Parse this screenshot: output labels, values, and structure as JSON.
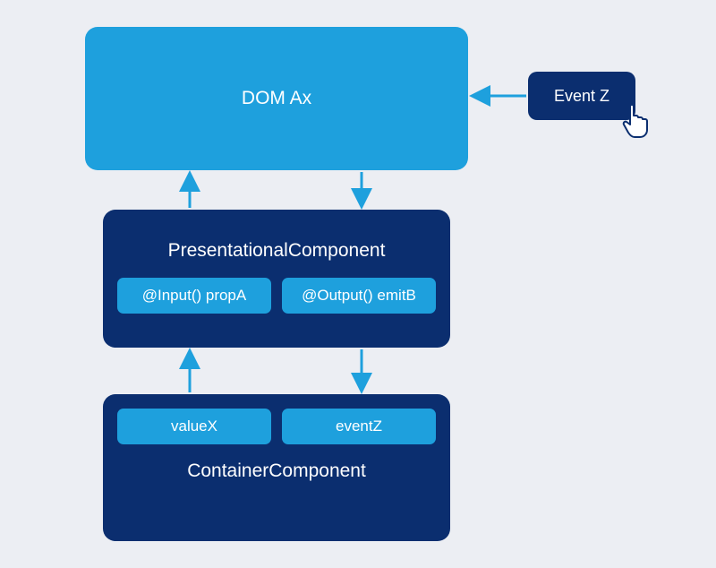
{
  "dom": {
    "label": "DOM Ax"
  },
  "event": {
    "label": "Event Z"
  },
  "presentational": {
    "title": "PresentationalComponent",
    "input_pill": "@Input() propA",
    "output_pill": "@Output() emitB"
  },
  "container": {
    "title": "ContainerComponent",
    "value_pill": "valueX",
    "event_pill": "eventZ"
  },
  "colors": {
    "light_blue": "#1ea0dd",
    "dark_blue": "#0b2e6f",
    "background": "#eceef3"
  },
  "arrows": [
    {
      "from": "event-box",
      "to": "dom-box",
      "direction": "left"
    },
    {
      "from": "presentational-input",
      "to": "dom-box",
      "direction": "up"
    },
    {
      "from": "dom-box",
      "to": "presentational-output",
      "direction": "down"
    },
    {
      "from": "container-value",
      "to": "presentational-input",
      "direction": "up"
    },
    {
      "from": "presentational-output",
      "to": "container-event",
      "direction": "down"
    }
  ]
}
